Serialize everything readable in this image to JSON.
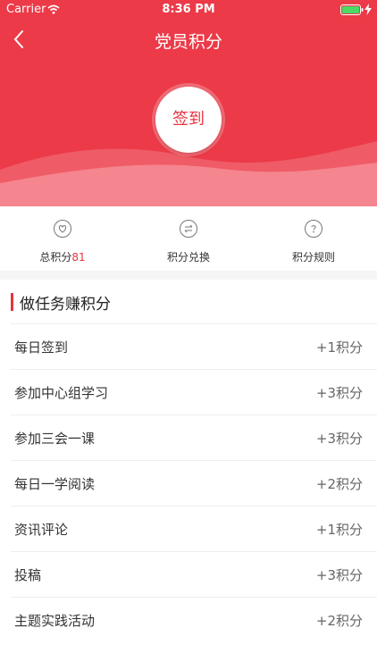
{
  "status_bar": {
    "carrier": "Carrier",
    "time": "8:36 PM"
  },
  "nav": {
    "title": "党员积分",
    "back_icon": "chevron-left-icon"
  },
  "hero": {
    "sign_in_label": "签到",
    "background_color": "#ec3a48",
    "accent_color": "#e8323f"
  },
  "quick_menu": {
    "total_points_label": "总积分",
    "total_points_value": "81",
    "exchange_label": "积分兑换",
    "rules_label": "积分规则",
    "icons": [
      "heart-icon",
      "exchange-icon",
      "question-icon"
    ]
  },
  "section": {
    "title": "做任务赚积分"
  },
  "tasks": [
    {
      "name": "每日签到",
      "points": "+1积分"
    },
    {
      "name": "参加中心组学习",
      "points": "+3积分"
    },
    {
      "name": "参加三会一课",
      "points": "+3积分"
    },
    {
      "name": "每日一学阅读",
      "points": "+2积分"
    },
    {
      "name": "资讯评论",
      "points": "+1积分"
    },
    {
      "name": "投稿",
      "points": "+3积分"
    },
    {
      "name": "主题实践活动",
      "points": "+2积分"
    }
  ]
}
